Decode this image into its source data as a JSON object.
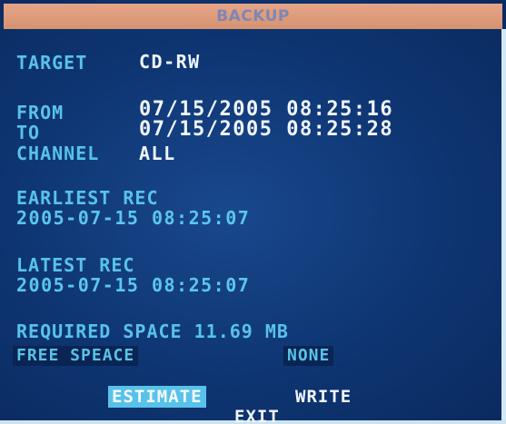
{
  "title": "BACKUP",
  "target": {
    "label": "TARGET",
    "value": "CD-RW"
  },
  "from": {
    "label": "FROM",
    "value": "07/15/2005 08:25:16"
  },
  "to": {
    "label": "TO",
    "value": "07/15/2005 08:25:28"
  },
  "channel": {
    "label": "CHANNEL",
    "value": "ALL"
  },
  "earliest_rec": {
    "label": "EARLIEST REC",
    "value": "2005-07-15 08:25:07"
  },
  "latest_rec": {
    "label": "LATEST REC",
    "value": "2005-07-15 08:25:07"
  },
  "required_space": {
    "text": "REQUIRED SPACE 11.69 MB"
  },
  "free_space": {
    "label": "FREE SPEACE",
    "value": "NONE"
  },
  "buttons": {
    "estimate": "ESTIMATE",
    "write": "WRITE",
    "exit": "EXIT"
  },
  "colors": {
    "title_bar": "#dc9c7a",
    "background": "#0e3572",
    "label": "#58c2ea",
    "value": "#f0f6ff",
    "selected": "#58c2ea"
  }
}
